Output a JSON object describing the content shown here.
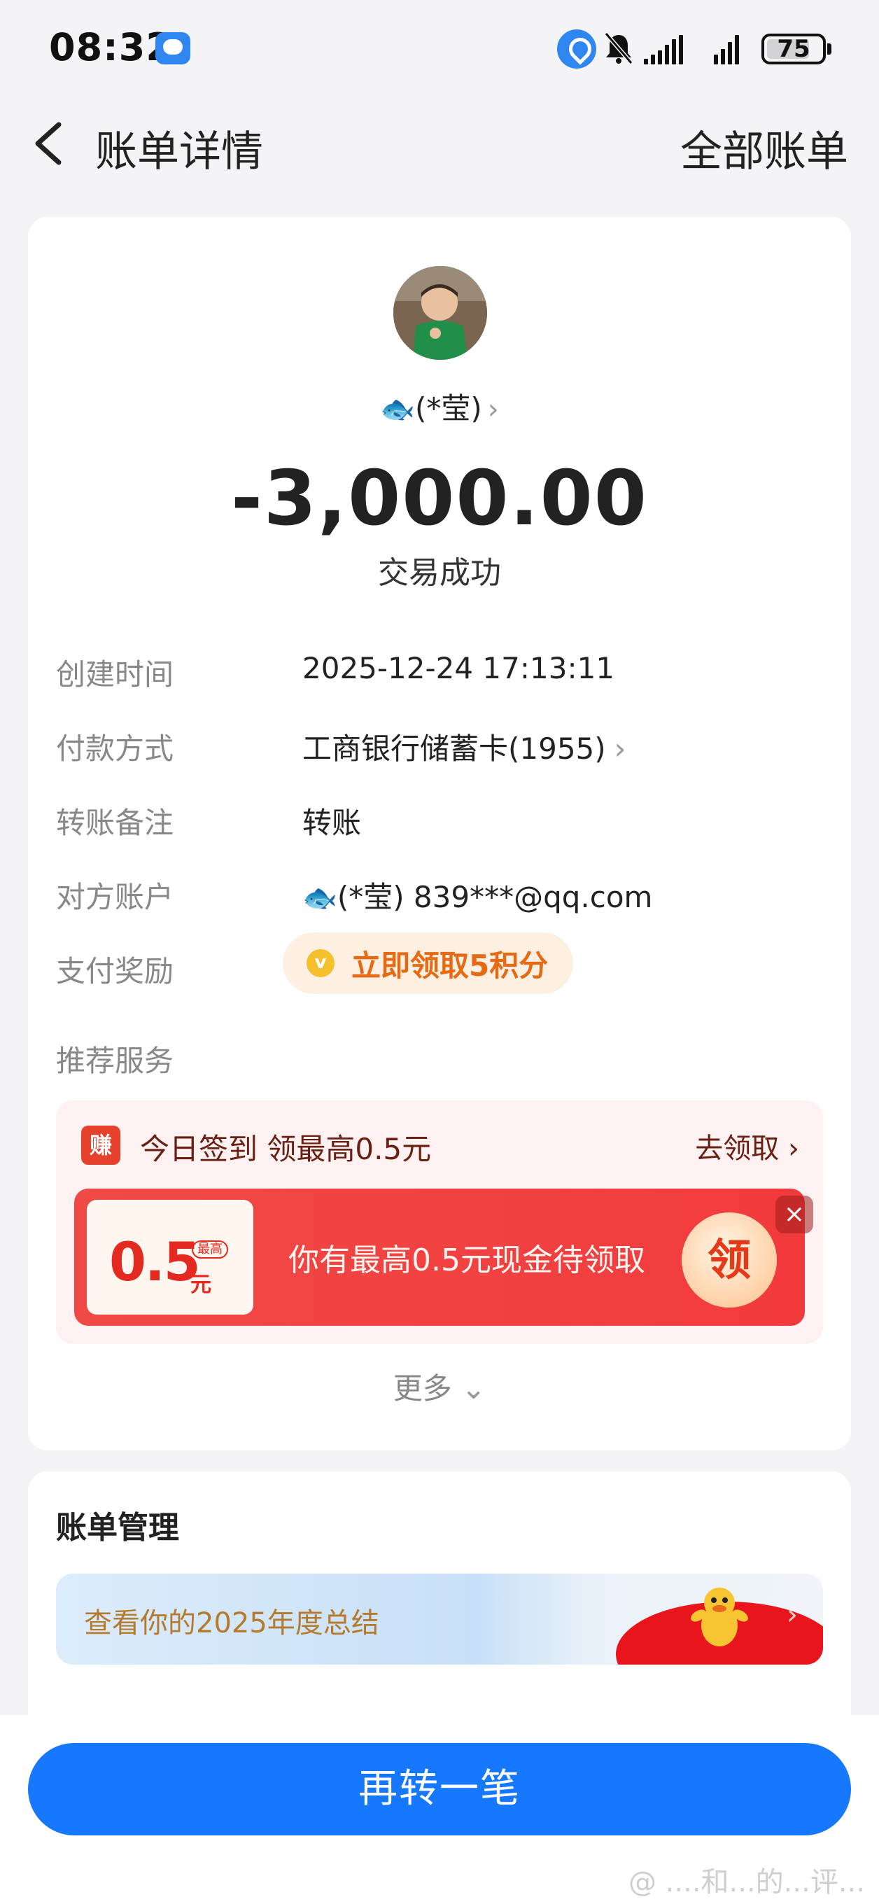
{
  "status_bar": {
    "time": "08:32",
    "battery": "75"
  },
  "nav": {
    "title": "账单详情",
    "right_link": "全部账单"
  },
  "transaction": {
    "payee_name": "(*莹)",
    "amount": "-3,000.00",
    "status": "交易成功",
    "details": [
      {
        "label": "创建时间",
        "value": "2025-12-24 17:13:11"
      },
      {
        "label": "付款方式",
        "value": "工商银行储蓄卡(1955)"
      },
      {
        "label": "转账备注",
        "value": "转账"
      },
      {
        "label": "对方账户",
        "value": "(*莹) 839***@qq.com"
      },
      {
        "label": "支付奖励",
        "value": "立即领取5积分"
      }
    ],
    "recommend_label": "推荐服务"
  },
  "promo": {
    "icon_text": "赚",
    "title": "今日签到  领最高0.5元",
    "link": "去领取",
    "ticket_value": "0.5",
    "ticket_unit": "元",
    "ticket_tag": "最高",
    "banner_text": "你有最高0.5元现金待领取",
    "claim": "领",
    "close": "×"
  },
  "more": "更多",
  "bill_management": {
    "title": "账单管理",
    "summary_text": "查看你的2025年度总结"
  },
  "cta": "再转一笔",
  "watermark": "@ ....和...的...评...",
  "colors": {
    "primary": "#1677ff",
    "promo_red": "#f04a46",
    "reward_orange": "#e56a13"
  }
}
